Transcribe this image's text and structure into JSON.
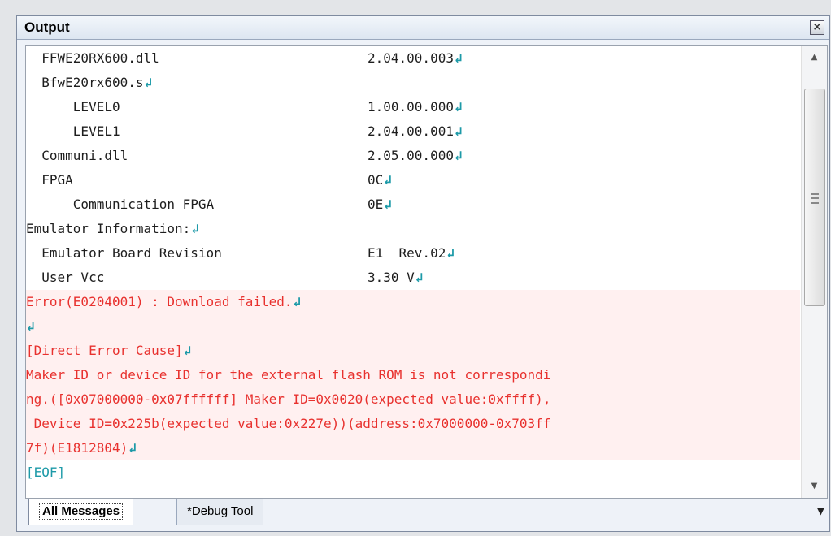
{
  "panel": {
    "title": "Output"
  },
  "eol_mark": "↲",
  "lines": [
    {
      "text": "  FFWE20RX600.dll",
      "value": "2.04.00.003",
      "eol": true,
      "type": "info"
    },
    {
      "text": "  BfwE20rx600.s",
      "value": "",
      "eol": true,
      "type": "info"
    },
    {
      "text": "      LEVEL0",
      "value": "1.00.00.000",
      "eol": true,
      "type": "info"
    },
    {
      "text": "      LEVEL1",
      "value": "2.04.00.001",
      "eol": true,
      "type": "info"
    },
    {
      "text": "  Communi.dll",
      "value": "2.05.00.000",
      "eol": true,
      "type": "info"
    },
    {
      "text": "  FPGA",
      "value": "0C",
      "eol": true,
      "type": "info"
    },
    {
      "text": "      Communication FPGA",
      "value": "0E",
      "eol": true,
      "type": "info"
    },
    {
      "text": "Emulator Information:",
      "value": "",
      "eol": true,
      "type": "info"
    },
    {
      "text": "  Emulator Board Revision",
      "value": "E1  Rev.02",
      "eol": true,
      "type": "info"
    },
    {
      "text": "  User Vcc",
      "value": "3.30 V",
      "eol": true,
      "type": "info"
    },
    {
      "text": "Error(E0204001) : Download failed.",
      "value": "",
      "eol": true,
      "type": "error"
    },
    {
      "text": "",
      "value": "",
      "eol": true,
      "type": "error"
    },
    {
      "text": "[Direct Error Cause]",
      "value": "",
      "eol": true,
      "type": "error"
    },
    {
      "text": "Maker ID or device ID for the external flash ROM is not correspondi",
      "value": "",
      "eol": false,
      "type": "error"
    },
    {
      "text": "ng.([0x07000000-0x07ffffff] Maker ID=0x0020(expected value:0xffff),",
      "value": "",
      "eol": false,
      "type": "error"
    },
    {
      "text": " Device ID=0x225b(expected value:0x227e))(address:0x7000000-0x703ff",
      "value": "",
      "eol": false,
      "type": "error"
    },
    {
      "text": "7f)(E1812804)",
      "value": "",
      "eol": true,
      "type": "error"
    },
    {
      "text": "[EOF]",
      "value": "",
      "eol": false,
      "type": "eof"
    }
  ],
  "tabs": [
    {
      "label": "All Messages",
      "active": true
    },
    {
      "label": "*Debug Tool",
      "active": false
    }
  ],
  "icons": {
    "close": "close-icon",
    "scroll_up": "scroll-up-icon",
    "scroll_down": "scroll-down-icon",
    "tab_menu": "dropdown-arrow-icon"
  },
  "colors": {
    "error_text": "#e8312e",
    "error_bg": "#fff0f0",
    "eol_mark": "#1d9aa8"
  }
}
